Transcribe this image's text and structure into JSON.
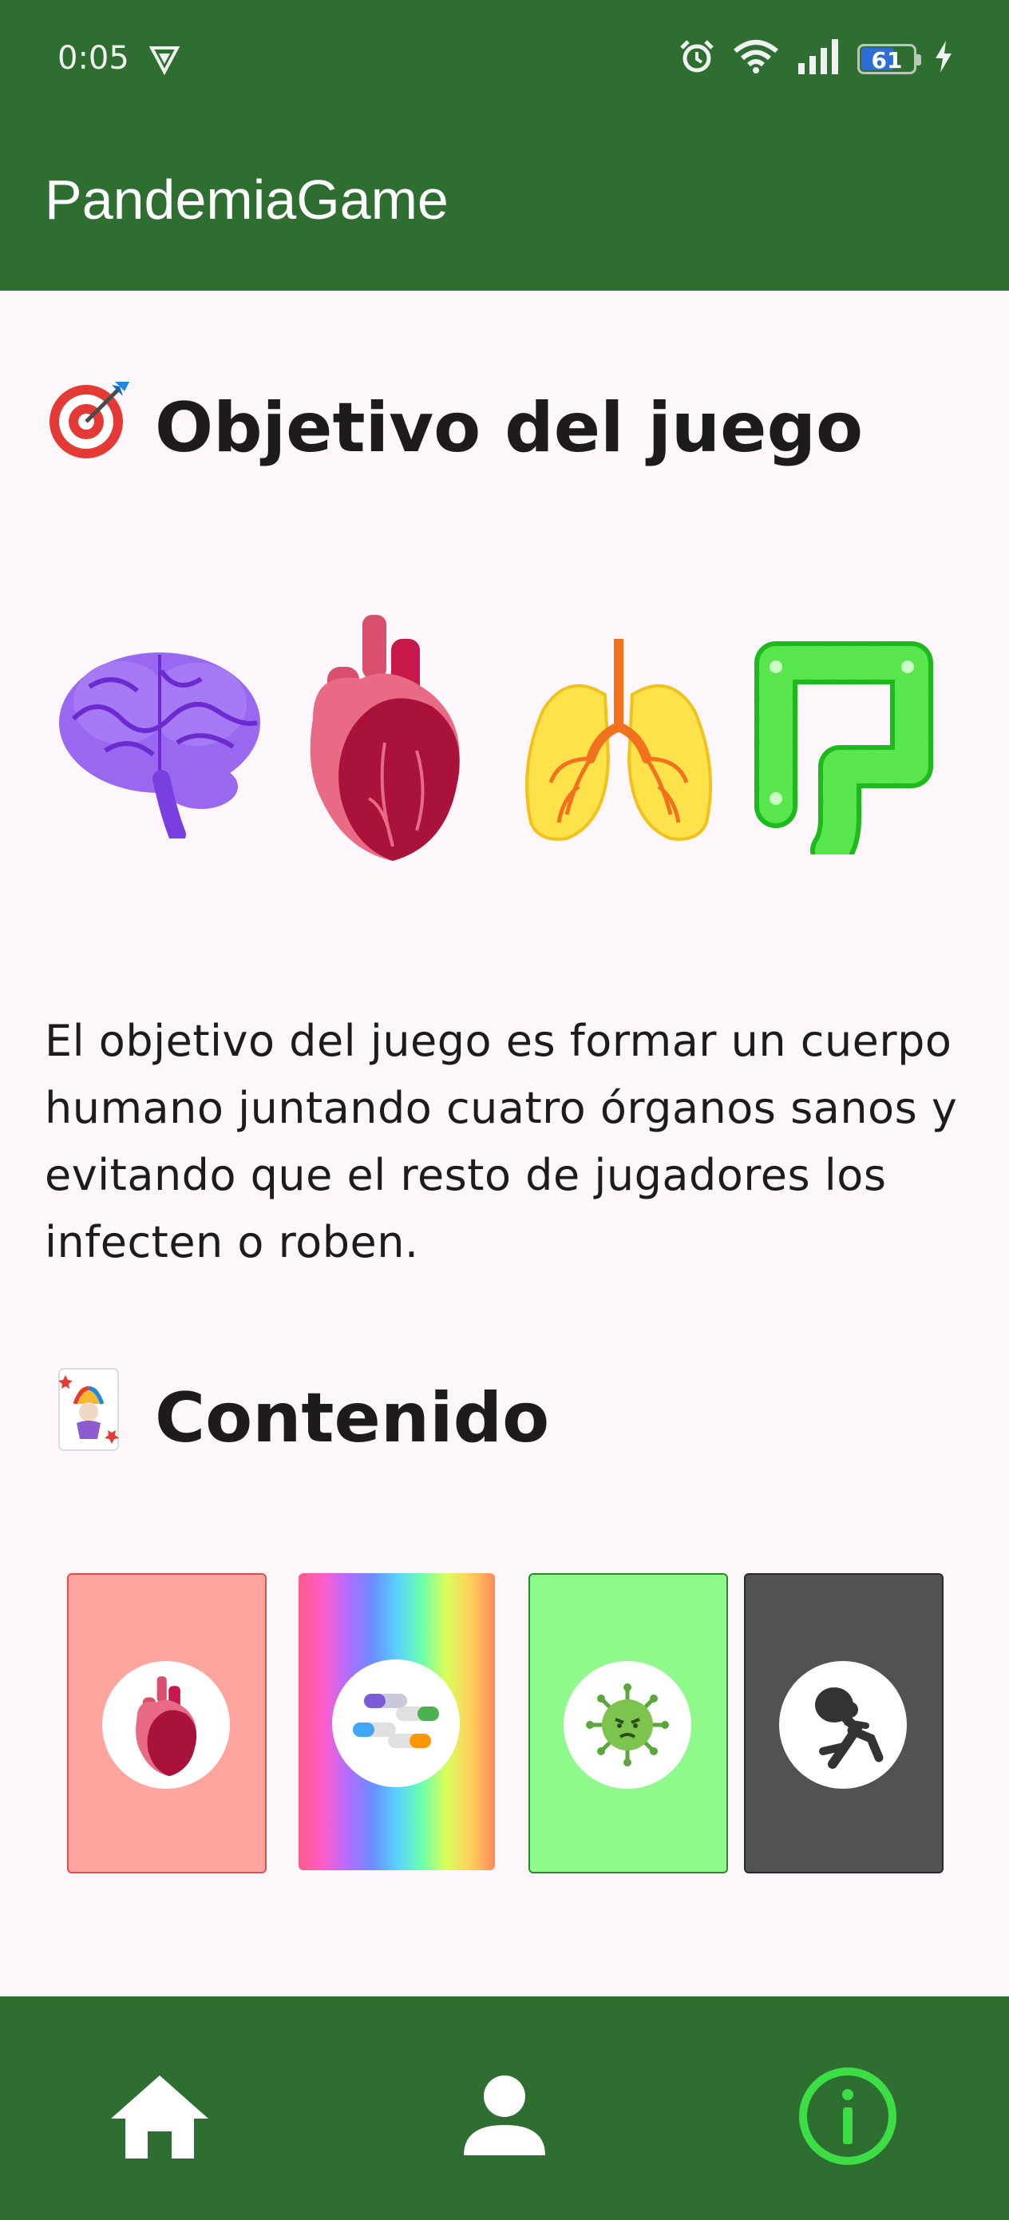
{
  "status_bar": {
    "time": "0:05",
    "battery_level": "61",
    "icons": [
      "vpn-icon",
      "alarm-icon",
      "wifi-icon",
      "signal-icon",
      "battery-icon",
      "charging-icon"
    ]
  },
  "app_bar": {
    "title": "PandemiaGame"
  },
  "objective": {
    "heading": "Objetivo del juego",
    "heading_icon": "target-icon",
    "organs": [
      "brain-icon",
      "heart-icon",
      "lungs-icon",
      "intestine-icon"
    ],
    "description": "El objetivo del juego es formar un cuerpo humano juntando cuatro órganos sanos y evitando que el resto de jugadores los infecten o roben."
  },
  "content": {
    "heading": "Contenido",
    "heading_icon": "joker-card-icon",
    "cards": [
      {
        "type": "organ",
        "icon": "heart-icon",
        "color": "#ffa5a0"
      },
      {
        "type": "medicine",
        "icon": "pills-icon",
        "color": "rainbow"
      },
      {
        "type": "virus",
        "icon": "virus-icon",
        "color": "#8ff98c"
      },
      {
        "type": "treatment",
        "icon": "thief-icon",
        "color": "#525252"
      }
    ]
  },
  "bottom_nav": {
    "items": [
      {
        "name": "home",
        "icon": "home-icon",
        "active": false
      },
      {
        "name": "profile",
        "icon": "person-icon",
        "active": false
      },
      {
        "name": "info",
        "icon": "info-icon",
        "active": true
      }
    ],
    "active_color": "#3ddd45"
  }
}
